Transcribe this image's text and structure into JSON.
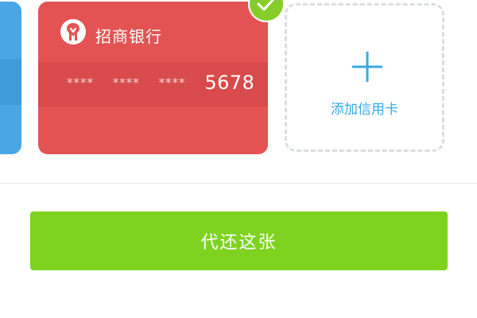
{
  "colors": {
    "prev_card_blue": "#4aa6e4",
    "bank_card_red": "#e35354",
    "accent_green": "#7ed321",
    "accent_blue": "#38a9e6",
    "dashed_gray": "#d9dde2"
  },
  "cards": {
    "selected_card": {
      "bank_name": "招商银行",
      "masked_groups": [
        "****",
        "****",
        "****"
      ],
      "last4": "5678",
      "logo_icon": "cmb-bank-logo-icon",
      "selected_icon": "check-icon"
    },
    "add_card": {
      "icon": "plus-icon",
      "label": "添加信用卡"
    }
  },
  "actions": {
    "repay_label": "代还这张"
  }
}
